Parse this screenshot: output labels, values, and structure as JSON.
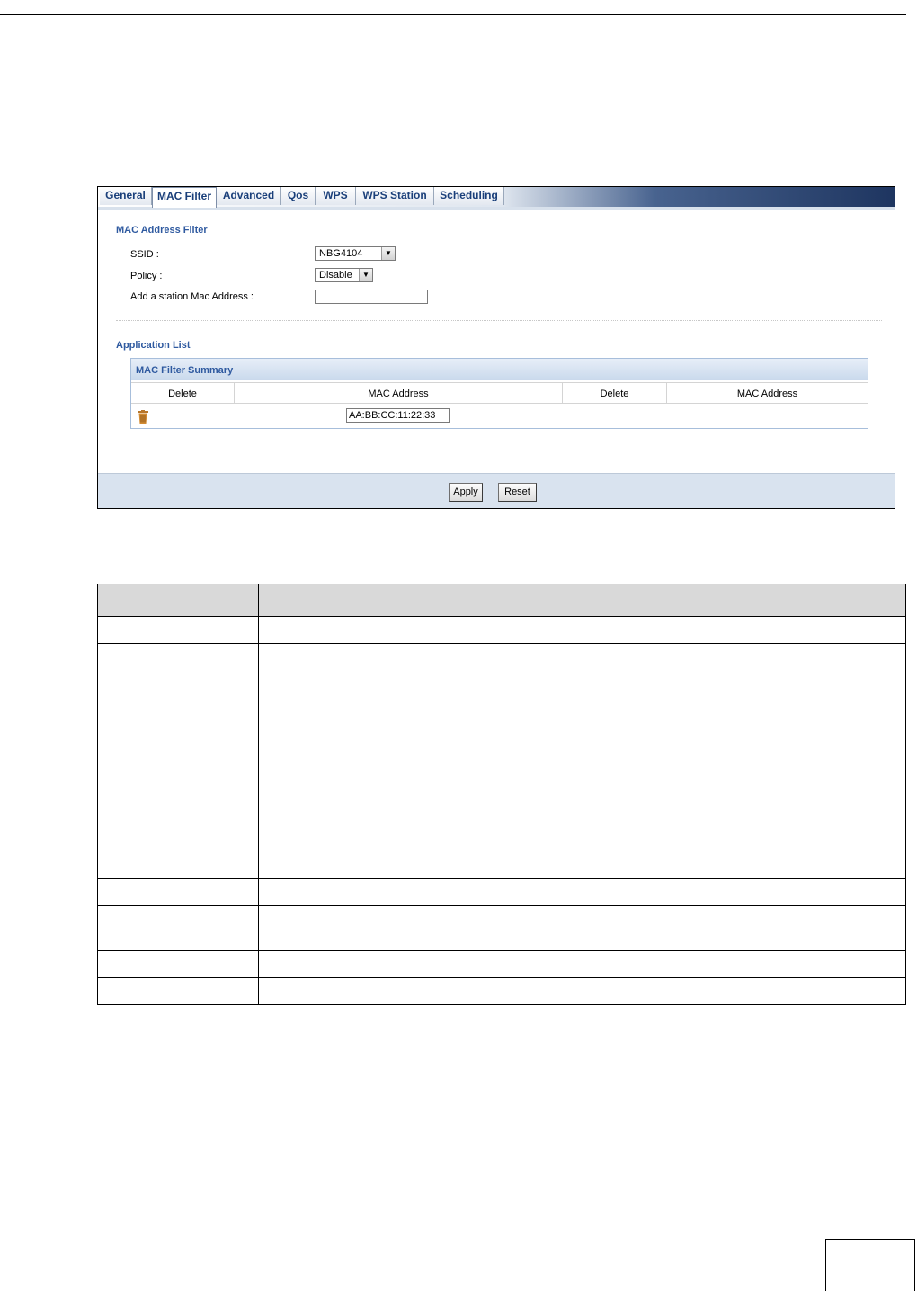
{
  "tabs": [
    {
      "label": "General"
    },
    {
      "label": "MAC Filter"
    },
    {
      "label": "Advanced"
    },
    {
      "label": "Qos"
    },
    {
      "label": "WPS"
    },
    {
      "label": "WPS Station"
    },
    {
      "label": "Scheduling"
    }
  ],
  "active_tab": "MAC Filter",
  "mac_filter": {
    "section_title": "MAC Address Filter",
    "ssid_label": "SSID :",
    "ssid_value": "NBG4104",
    "policy_label": "Policy :",
    "policy_value": "Disable",
    "add_label": "Add a station Mac Address :",
    "add_value": ""
  },
  "application_list": {
    "title": "Application List",
    "summary_title": "MAC Filter Summary",
    "columns": [
      "Delete",
      "MAC Address",
      "Delete",
      "MAC Address"
    ],
    "rows": [
      {
        "mac": "AA:BB:CC:11:22:33"
      }
    ]
  },
  "buttons": {
    "apply": "Apply",
    "reset": "Reset"
  },
  "icons": {
    "trash": "trash-icon",
    "dropdown": "chevron-down-icon"
  }
}
